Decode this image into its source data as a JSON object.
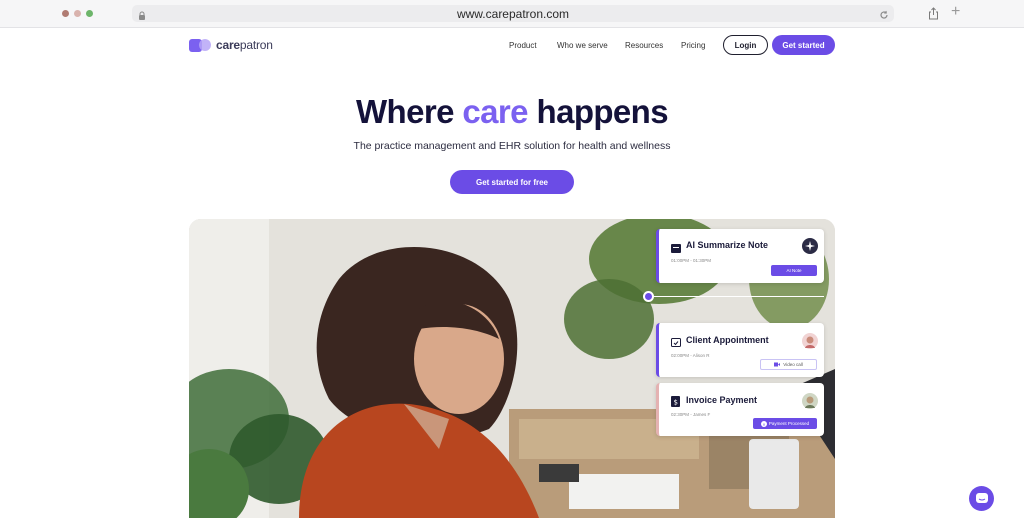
{
  "browser": {
    "url": "www.carepatron.com"
  },
  "nav": {
    "logo_bold": "care",
    "logo_light": "patron",
    "links": [
      "Product",
      "Who we serve",
      "Resources",
      "Pricing"
    ],
    "login_label": "Login",
    "get_started_label": "Get started"
  },
  "hero": {
    "title_part1": "Where ",
    "title_accent": "care",
    "title_part2": " happens",
    "subtitle": "The practice management and EHR solution for health and wellness",
    "cta_label": "Get started for free"
  },
  "cards": {
    "ai_note": {
      "title": "AI Summarize Note",
      "meta": "01:00PM - 01:30PM",
      "tag": "AI Note"
    },
    "appointment": {
      "title": "Client Appointment",
      "meta": "02:00PM - Alison R",
      "tag": "Video call"
    },
    "invoice": {
      "title": "Invoice Payment",
      "meta": "02:30PM - James F",
      "tag": "Payment Processed"
    }
  },
  "colors": {
    "brand": "#6b4ce6",
    "accent_text": "#7b61f0",
    "heading": "#14123a"
  }
}
